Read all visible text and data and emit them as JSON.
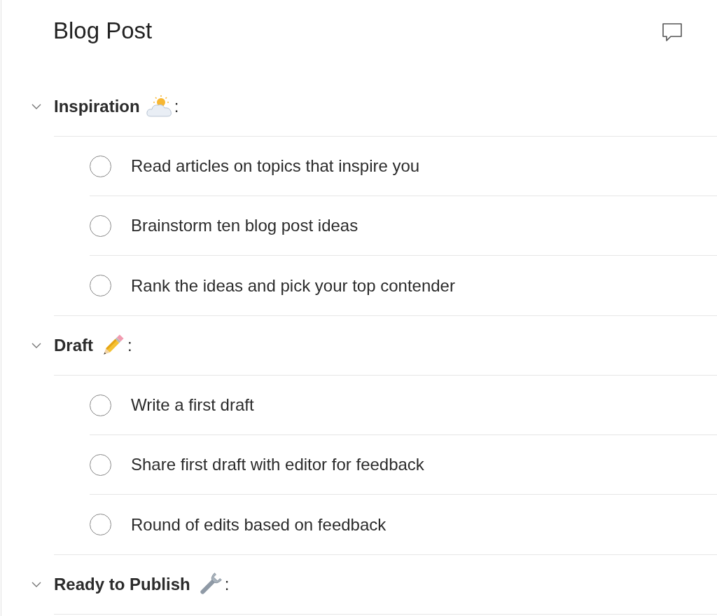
{
  "title": "Blog Post",
  "sections": [
    {
      "title": "Inspiration",
      "kind": "weather",
      "suffix": ":",
      "expanded": true,
      "tasks": [
        {
          "text": "Read articles on topics that inspire you",
          "checked": false
        },
        {
          "text": "Brainstorm ten blog post ideas",
          "checked": false
        },
        {
          "text": "Rank the ideas and pick your top contender",
          "checked": false
        }
      ]
    },
    {
      "title": "Draft",
      "kind": "writing",
      "suffix": ":",
      "expanded": true,
      "tasks": [
        {
          "text": "Write a first draft",
          "checked": false
        },
        {
          "text": "Share first draft with editor for feedback",
          "checked": false
        },
        {
          "text": "Round of edits based on feedback",
          "checked": false
        }
      ]
    },
    {
      "title": "Ready to Publish",
      "kind": "tools",
      "suffix": ":",
      "expanded": true
    }
  ]
}
